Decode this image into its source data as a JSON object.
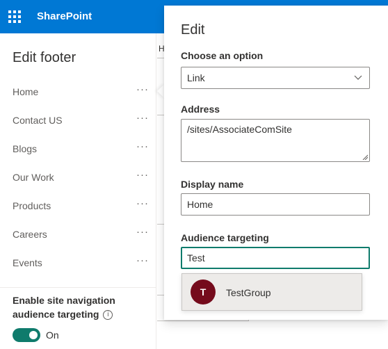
{
  "topbar": {
    "app_name": "SharePoint",
    "waffle_icon": "waffle-icon",
    "more_icon": "grid-icon",
    "color": "#0078d4"
  },
  "background": {
    "tab_fragment": "H"
  },
  "left_panel": {
    "title": "Edit footer",
    "items": [
      {
        "label": "Home",
        "more": "···"
      },
      {
        "label": "Contact US",
        "more": "···"
      },
      {
        "label": "Blogs",
        "more": "···"
      },
      {
        "label": "Our Work",
        "more": "···"
      },
      {
        "label": "Products",
        "more": "···"
      },
      {
        "label": "Careers",
        "more": "···"
      },
      {
        "label": "Events",
        "more": "···"
      }
    ],
    "targeting_label": "Enable site navigation audience targeting",
    "info_icon": "info-icon",
    "toggle_on": true,
    "toggle_text": "On",
    "toggle_color": "#0f7b6c"
  },
  "edit_callout": {
    "title": "Edit",
    "option_label": "Choose an option",
    "option_value": "Link",
    "address_label": "Address",
    "address_value": "/sites/AssociateComSite",
    "display_name_label": "Display name",
    "display_name_value": "Home",
    "audience_label": "Audience targeting",
    "audience_value": "Test"
  },
  "suggestion": {
    "initial": "T",
    "name": "TestGroup",
    "avatar_color": "#750b1c"
  }
}
